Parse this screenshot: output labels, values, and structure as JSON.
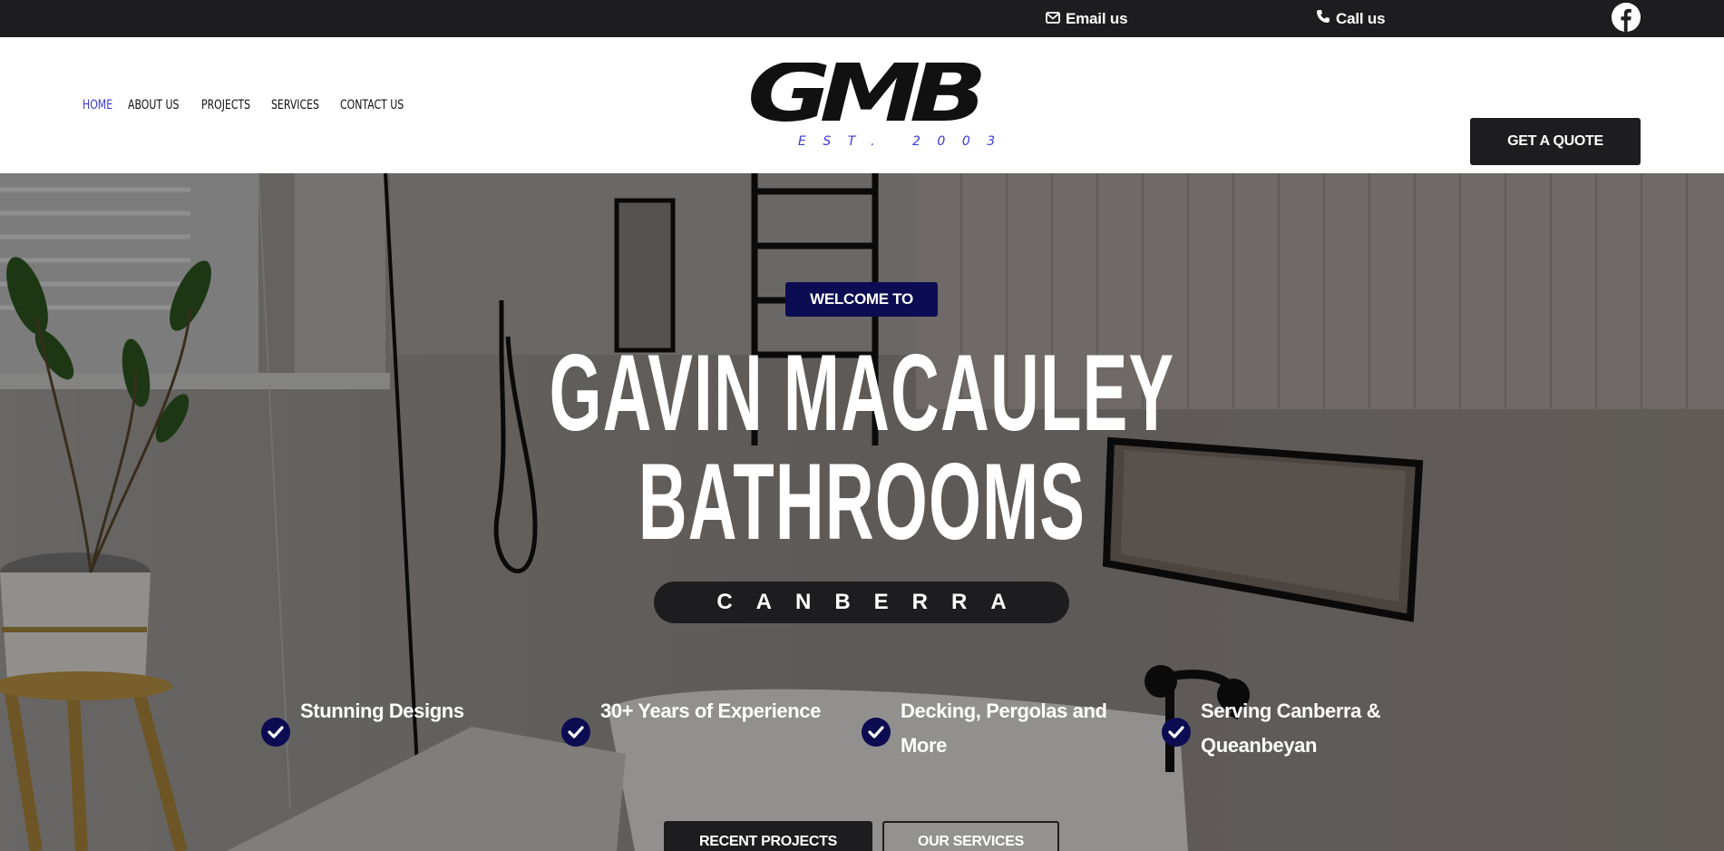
{
  "topbar": {
    "email_label": "Email us",
    "call_label": "Call us",
    "social": "facebook-icon"
  },
  "nav": {
    "items": [
      {
        "label": "Home",
        "active": true
      },
      {
        "label": "About Us"
      },
      {
        "label": "Projects"
      },
      {
        "label": "Services"
      },
      {
        "label": "Contact Us"
      }
    ],
    "active_color": "#3b3bd6"
  },
  "logo": {
    "text": "GMB",
    "tagline": "EST. 2003"
  },
  "header": {
    "cta_label": "GET A QUOTE"
  },
  "hero": {
    "eyebrow": "WELCOME TO",
    "title_line1": "GAVIN MACAULEY",
    "title_line2": "BATHROOMS",
    "city": "CANBERRA",
    "features": [
      {
        "text": "Stunning Designs"
      },
      {
        "text": "30+ Years of Experience"
      },
      {
        "text": "Decking, Pergolas and More"
      },
      {
        "text": "Serving Canberra & Queanbeyan"
      }
    ],
    "primary_button": "RECENT PROJECTS",
    "secondary_button": "OUR SERVICES"
  },
  "colors": {
    "dark": "#1d1d1f",
    "navy": "#0c0c52",
    "accent": "#3b3bd6"
  }
}
